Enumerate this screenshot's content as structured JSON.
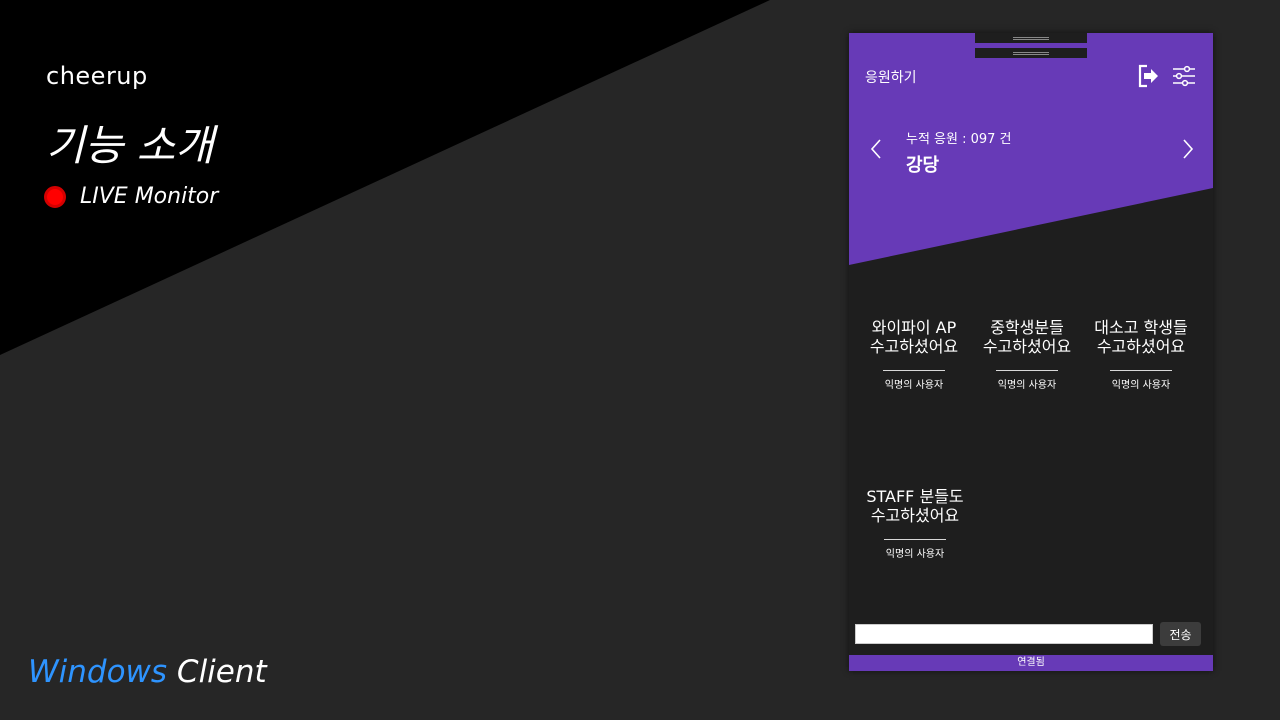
{
  "slide": {
    "brand": "cheerup",
    "headline": "기능 소개",
    "live_label": "LIVE Monitor",
    "platform_part1": "Windows",
    "platform_part2": "Client",
    "colors": {
      "live_dot": "#ff0000",
      "platform_accent": "#2e94ff"
    }
  },
  "app": {
    "title": "응원하기",
    "icons": {
      "logout": "logout-icon",
      "settings": "sliders-icon",
      "prev": "chevron-left-icon",
      "next": "chevron-right-icon"
    },
    "count_line": "누적 응원 : 097 건",
    "place": "강당",
    "accent_color": "#673ab7",
    "cards": [
      {
        "message": "와이파이 AP\n수고하셨어요",
        "author": "익명의 사용자"
      },
      {
        "message": "중학생분들\n수고하셨어요",
        "author": "익명의 사용자"
      },
      {
        "message": "대소고 학생들\n수고하셨어요",
        "author": "익명의 사용자"
      },
      {
        "message": "STAFF 분들도\n수고하셨어요",
        "author": "익명의 사용자"
      }
    ],
    "input": {
      "value": "",
      "placeholder": ""
    },
    "send_label": "전송",
    "status": "연결됨"
  }
}
